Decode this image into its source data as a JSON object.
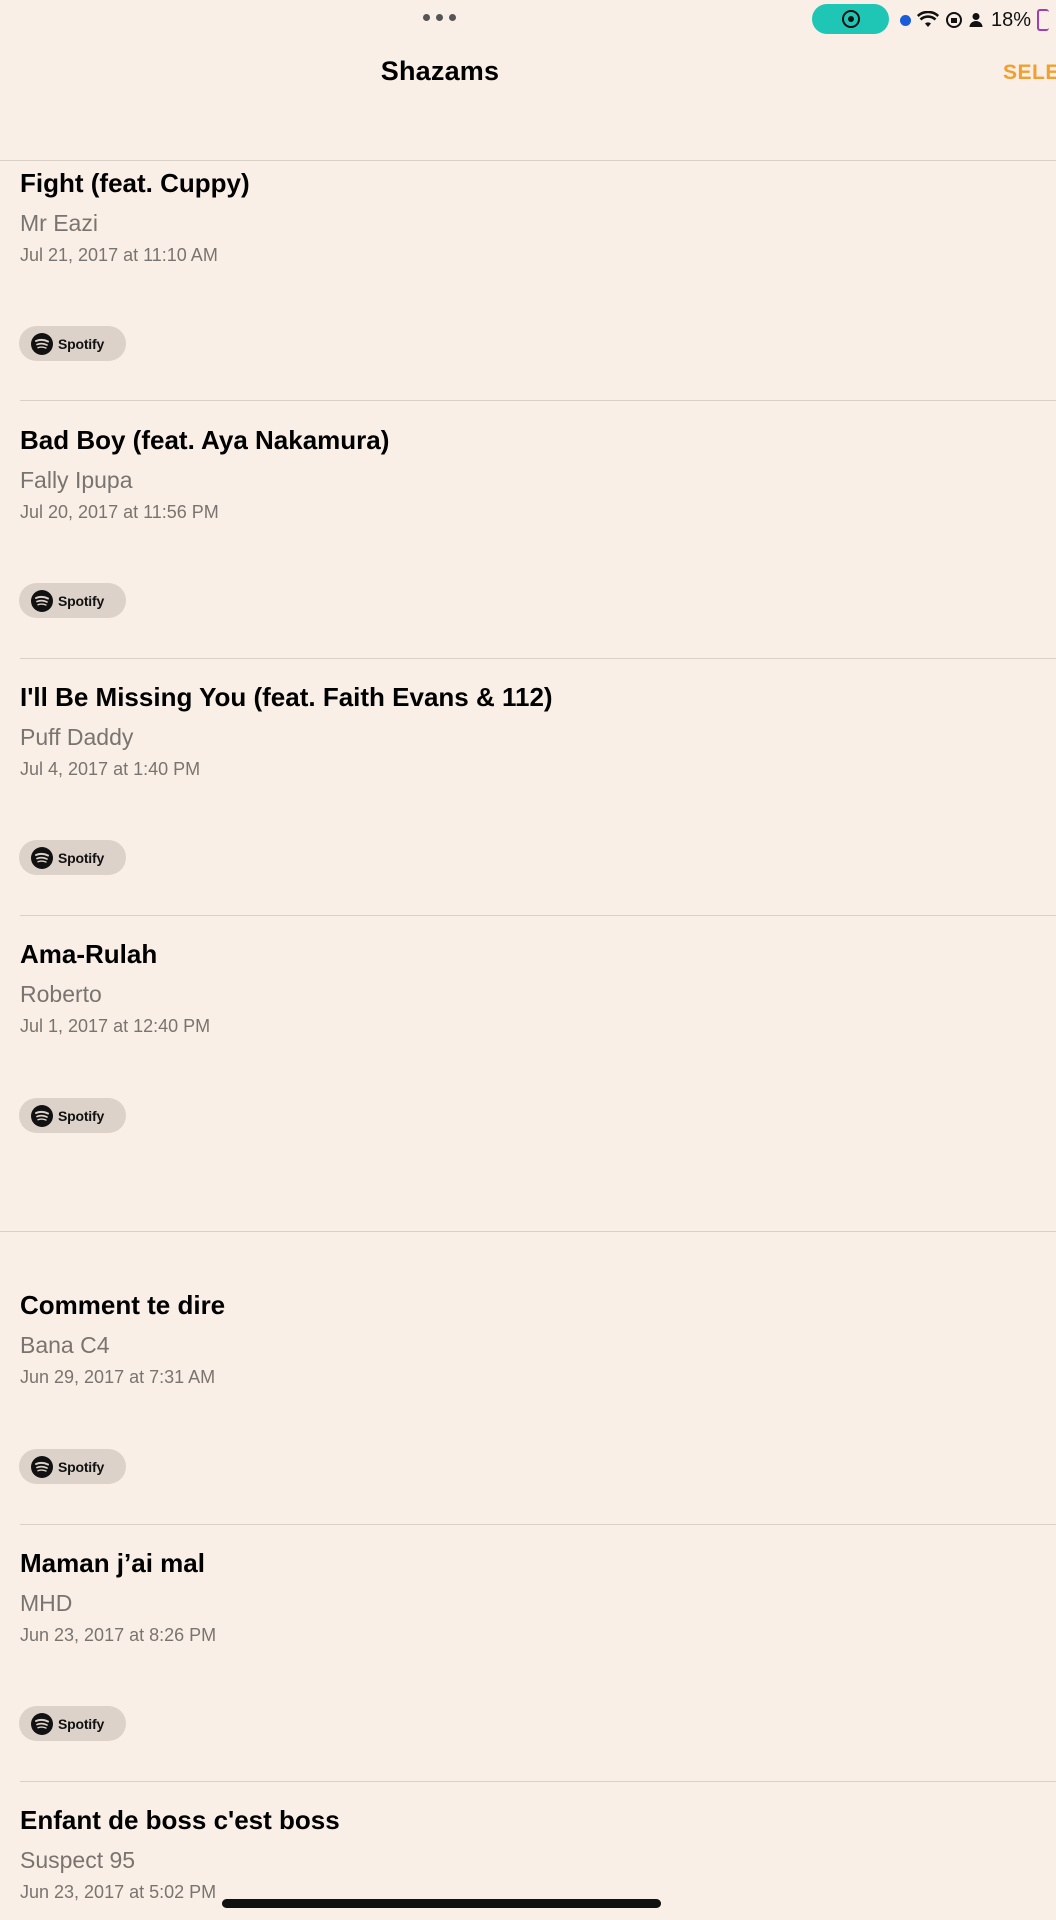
{
  "status_bar": {
    "battery": "18%"
  },
  "header": {
    "title": "Shazams",
    "select_label": "SELE"
  },
  "songs": [
    {
      "title": "Fight (feat. Cuppy)",
      "artist": "Mr Eazi",
      "date": "Jul 21, 2017 at 11:10 AM",
      "provider": "Spotify"
    },
    {
      "title": "Bad Boy (feat. Aya Nakamura)",
      "artist": "Fally Ipupa",
      "date": "Jul 20, 2017 at 11:56 PM",
      "provider": "Spotify"
    },
    {
      "title": "I'll Be Missing You (feat. Faith Evans & 112)",
      "artist": "Puff Daddy",
      "date": "Jul 4, 2017 at 1:40 PM",
      "provider": "Spotify"
    },
    {
      "title": "Ama-Rulah",
      "artist": "Roberto",
      "date": "Jul 1, 2017 at 12:40 PM",
      "provider": "Spotify"
    },
    {
      "title": "Comment te dire",
      "artist": "Bana C4",
      "date": "Jun 29, 2017 at 7:31 AM",
      "provider": "Spotify"
    },
    {
      "title": "Maman j’ai mal",
      "artist": "MHD",
      "date": "Jun 23, 2017 at 8:26 PM",
      "provider": "Spotify"
    },
    {
      "title": "Enfant de boss c'est boss",
      "artist": "Suspect 95",
      "date": "Jun 23, 2017 at 5:02 PM",
      "provider": "Spotify"
    }
  ],
  "colors": {
    "background": "#f9efe6",
    "accent": "#f0a030",
    "record_pill": "#1fc6b5"
  }
}
